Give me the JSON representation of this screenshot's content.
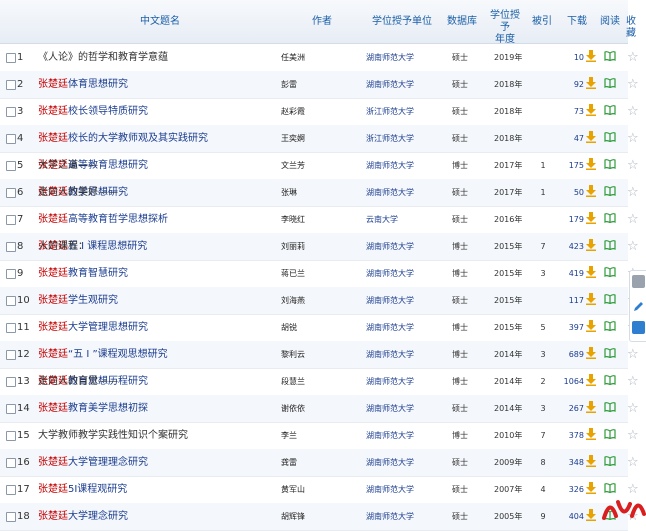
{
  "header": {
    "title_col": "中文题名",
    "author_col": "作者",
    "unit_col": "学位授予单位",
    "db_col": "数据库",
    "year_col_line1": "学位授予",
    "year_col_line2": "年度",
    "cite_col": "被引",
    "download_col": "下载",
    "read_col": "阅读",
    "fav_col": "收藏"
  },
  "rows": [
    {
      "no": "1",
      "pre": "《人论》的哲学和教育学意蕴",
      "hl": "",
      "post": "",
      "author": "任美洲",
      "unit": "湖南师范大学",
      "db": "硕士",
      "year": "2019年",
      "cite": "",
      "downloads": "10"
    },
    {
      "no": "2",
      "pre": "",
      "hl": "张楚廷",
      "post": "体育思想研究",
      "author": "彭雷",
      "unit": "湖南师范大学",
      "db": "硕士",
      "year": "2018年",
      "cite": "",
      "downloads": "92"
    },
    {
      "no": "3",
      "pre": "",
      "hl": "张楚廷",
      "post": "校长领导特质研究",
      "author": "赵彩霞",
      "unit": "浙江师范大学",
      "db": "硕士",
      "year": "2018年",
      "cite": "",
      "downloads": "73"
    },
    {
      "no": "4",
      "pre": "",
      "hl": "张楚廷",
      "post": "校长的大学教师观及其实践研究",
      "author": "王奕婀",
      "unit": "浙江师范大学",
      "db": "硕士",
      "year": "2018年",
      "cite": "",
      "downloads": "47"
    },
    {
      "no": "5",
      "pre": "大学之道——",
      "hl": "张楚廷",
      "post": "高等教育思想研究",
      "author": "文兰芳",
      "unit": "湖南师范大学",
      "db": "博士",
      "year": "2017年",
      "cite": "1",
      "downloads": "175"
    },
    {
      "no": "6",
      "pre": "走向人的美好——",
      "hl": "张楚廷",
      "post": "教学思想研究",
      "author": "张琳",
      "unit": "湖南师范大学",
      "db": "硕士",
      "year": "2017年",
      "cite": "1",
      "downloads": "50"
    },
    {
      "no": "7",
      "pre": "",
      "hl": "张楚廷",
      "post": "高等教育哲学思想探析",
      "author": "李晓红",
      "unit": "云南大学",
      "db": "硕士",
      "year": "2016年",
      "cite": "",
      "downloads": "179"
    },
    {
      "no": "8",
      "pre": "人的课程：",
      "hl": "张楚廷",
      "post": "五 I 课程思想研究",
      "author": "刘丽莉",
      "unit": "湖南师范大学",
      "db": "博士",
      "year": "2015年",
      "cite": "7",
      "downloads": "423"
    },
    {
      "no": "9",
      "pre": "",
      "hl": "张楚廷",
      "post": "教育智慧研究",
      "author": "蒋已兰",
      "unit": "湖南师范大学",
      "db": "博士",
      "year": "2015年",
      "cite": "3",
      "downloads": "419"
    },
    {
      "no": "10",
      "pre": "",
      "hl": "张楚廷",
      "post": "学生观研究",
      "author": "刘海燕",
      "unit": "湖南师范大学",
      "db": "硕士",
      "year": "2015年",
      "cite": "",
      "downloads": "117"
    },
    {
      "no": "11",
      "pre": "",
      "hl": "张楚廷",
      "post": "大学管理思想研究",
      "author": "胡锐",
      "unit": "湖南师范大学",
      "db": "博士",
      "year": "2015年",
      "cite": "5",
      "downloads": "397"
    },
    {
      "no": "12",
      "pre": "",
      "hl": "张楚廷",
      "post": "“五 I ”课程观思想研究",
      "author": "黎利云",
      "unit": "湖南师范大学",
      "db": "博士",
      "year": "2014年",
      "cite": "3",
      "downloads": "689"
    },
    {
      "no": "13",
      "pre": "走向人的自觉——",
      "hl": "张楚廷",
      "post": "教育思想历程研究",
      "author": "段慧兰",
      "unit": "湖南师范大学",
      "db": "博士",
      "year": "2014年",
      "cite": "2",
      "downloads": "1064"
    },
    {
      "no": "14",
      "pre": "",
      "hl": "张楚廷",
      "post": "教育美学思想初探",
      "author": "谢依依",
      "unit": "湖南师范大学",
      "db": "硕士",
      "year": "2014年",
      "cite": "3",
      "downloads": "267"
    },
    {
      "no": "15",
      "pre": "大学教师教学实践性知识个案研究",
      "hl": "",
      "post": "",
      "author": "李兰",
      "unit": "湖南师范大学",
      "db": "博士",
      "year": "2010年",
      "cite": "7",
      "downloads": "378"
    },
    {
      "no": "16",
      "pre": "",
      "hl": "张楚廷",
      "post": "大学管理理念研究",
      "author": "龚雷",
      "unit": "湖南师范大学",
      "db": "硕士",
      "year": "2009年",
      "cite": "8",
      "downloads": "348"
    },
    {
      "no": "17",
      "pre": "",
      "hl": "张楚廷",
      "post": "5I课程观研究",
      "author": "黄军山",
      "unit": "湖南师范大学",
      "db": "硕士",
      "year": "2007年",
      "cite": "4",
      "downloads": "326"
    },
    {
      "no": "18",
      "pre": "",
      "hl": "张楚廷",
      "post": "大学理念研究",
      "author": "胡辉锋",
      "unit": "湖南师范大学",
      "db": "硕士",
      "year": "2005年",
      "cite": "9",
      "downloads": "404"
    }
  ],
  "icons": {
    "download": "download-icon",
    "read": "open-book-icon",
    "favorite": "star-icon",
    "checkbox": "checkbox"
  },
  "colors": {
    "highlight": "#c40000",
    "link": "#1b3d8f",
    "header_text": "#1a5fa8",
    "download_icon": "#e8a300",
    "read_icon": "#2e9c3a"
  }
}
